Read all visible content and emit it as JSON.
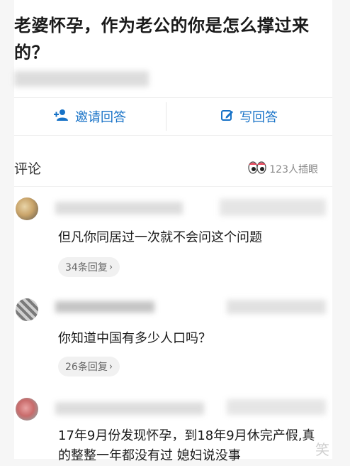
{
  "question": {
    "title": "老婆怀孕，作为老公的你是怎么撑过来的？"
  },
  "actions": {
    "invite_label": "邀请回答",
    "write_label": "写回答"
  },
  "comments_section": {
    "title": "评论",
    "stat": "123人插眼"
  },
  "comments": [
    {
      "text": "但凡你同居过一次就不会问这个问题",
      "replies": "34条回复"
    },
    {
      "text": "你知道中国有多少人口吗？",
      "replies": "26条回复"
    },
    {
      "text": "17年9月份发现怀孕，到18年9月休完产假,真的整整一年都没有过 媳妇说没事"
    }
  ],
  "colors": {
    "accent": "#1772c7",
    "page_background": "#f6f6f6"
  },
  "icons": {
    "invite": "add-person-icon",
    "write": "edit-pen-icon",
    "stat": "eyes-icon",
    "chevron": "chevron-right-icon"
  }
}
